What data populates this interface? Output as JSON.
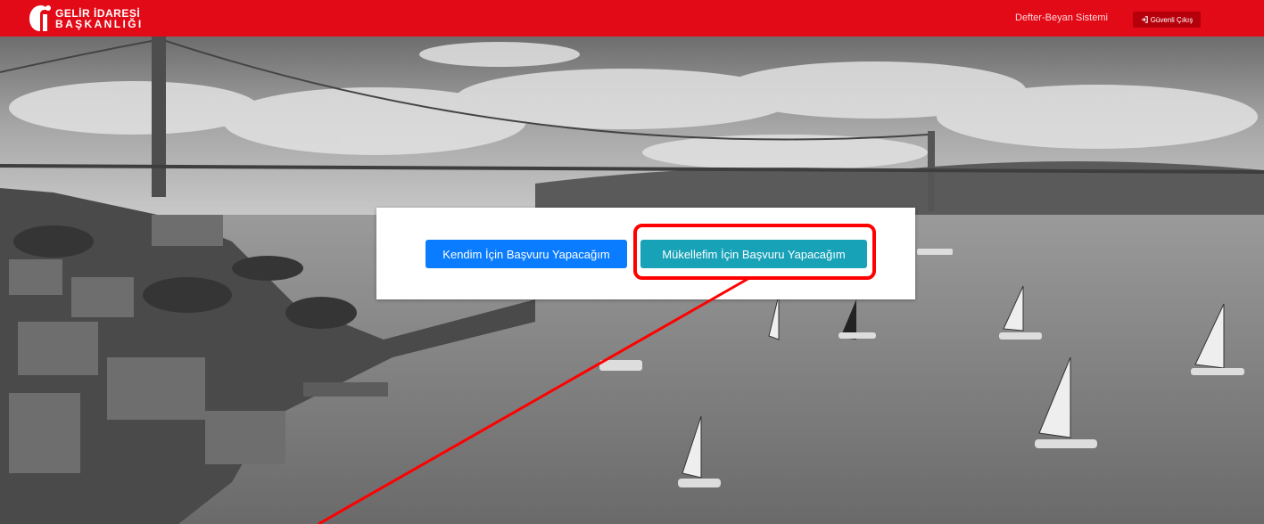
{
  "header": {
    "logo_line1": "GELİR İDARESİ",
    "logo_line2": "BAŞKANLIĞI",
    "system_link": "Defter-Beyan Sistemi",
    "logout_label": "Güvenli Çıkış",
    "brand_color": "#e30a17"
  },
  "dialog": {
    "self_button": "Kendim İçin Başvuru Yapacağım",
    "client_button": "Mükellefim İçin Başvuru Yapacağım",
    "self_button_color": "#0a7cff",
    "client_button_color": "#17a2b8"
  },
  "annotation": {
    "color": "#ff0000",
    "target": "client_button"
  }
}
